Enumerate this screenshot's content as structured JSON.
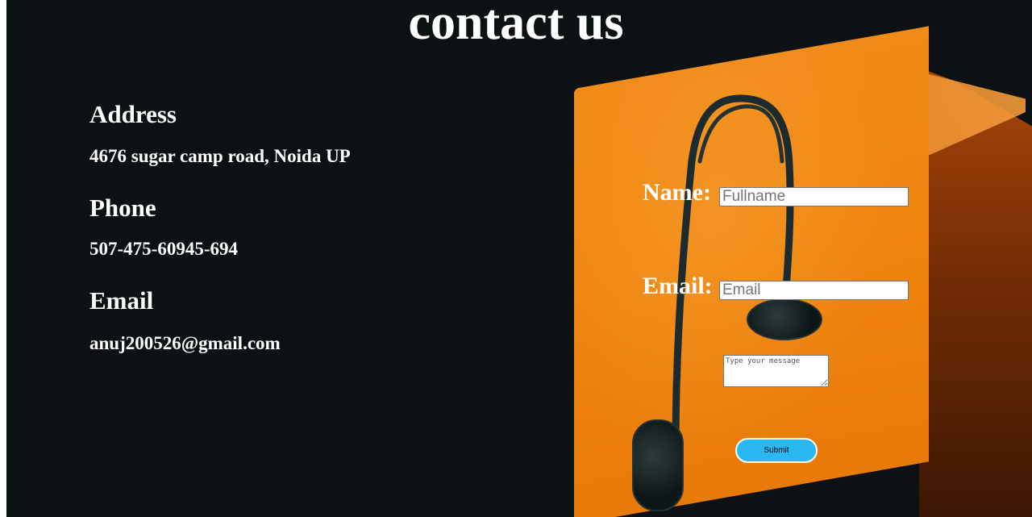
{
  "page": {
    "title": "contact us"
  },
  "info": {
    "address_heading": "Address",
    "address_value": "4676 sugar camp road, Noida UP",
    "phone_heading": "Phone",
    "phone_value": "507-475-60945-694",
    "email_heading": "Email",
    "email_value": "anuj200526@gmail.com"
  },
  "form": {
    "name_label": "Name:",
    "name_placeholder": "Fullname",
    "email_label": "Email:",
    "email_placeholder": "Email",
    "message_placeholder": "Type your message",
    "submit_label": "Submit"
  },
  "colors": {
    "page_background": "#0c1114",
    "accent_orange": "#f08a18",
    "submit_button": "#29b8f0",
    "text": "#ffffff"
  },
  "background_image": "orange box with black earphones hanging over it"
}
